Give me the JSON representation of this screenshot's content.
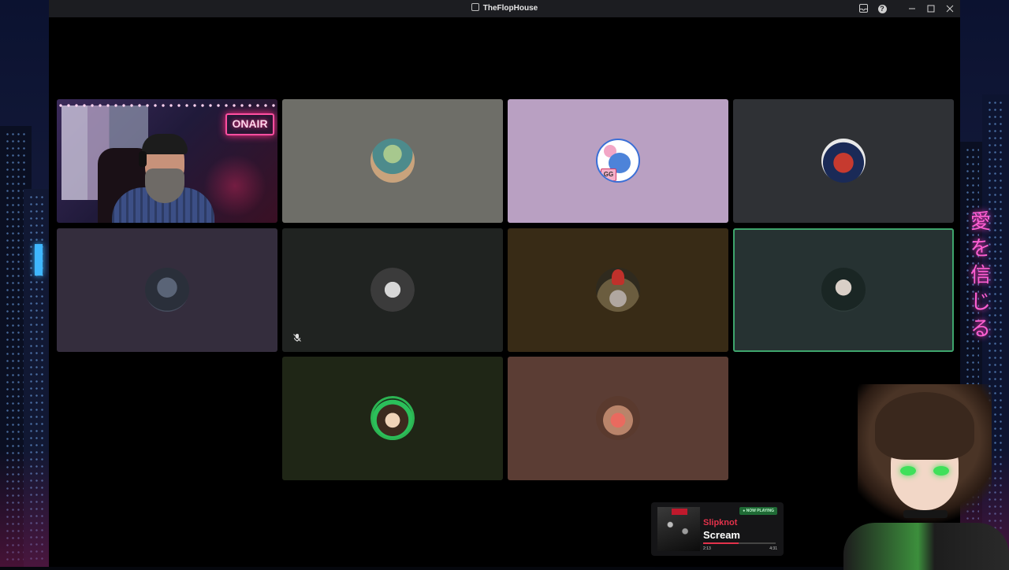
{
  "window": {
    "title": "TheFlopHouse"
  },
  "camera_tile": {
    "sign_text": "ONAIR"
  },
  "participants": [
    {
      "avatar": "camera-feed",
      "bg": "#3a2f4a"
    },
    {
      "avatar": "doll-avatar",
      "bg": "#6e6e68"
    },
    {
      "avatar": "stitch-avatar",
      "bg": "#b9a0c2",
      "avatar_text": "GG"
    },
    {
      "avatar": "badge-avatar",
      "bg": "#2f3135"
    },
    {
      "avatar": "dragon-avatar",
      "bg": "#342d3d"
    },
    {
      "avatar": "skull-avatar",
      "bg": "#202321",
      "muted": true
    },
    {
      "avatar": "gnome-avatar",
      "bg": "#382b16"
    },
    {
      "avatar": "woman-avatar",
      "bg": "#263232",
      "speaking": true
    },
    {
      "avatar": "kid-avatar",
      "bg": "#1f2616"
    },
    {
      "avatar": "girl-avatar",
      "bg": "#5b3d34"
    }
  ],
  "now_playing": {
    "badge": "● NOW PLAYING",
    "artist": "Slipknot",
    "song": "Scream",
    "current_time": "2:13",
    "total_time": "4:31",
    "progress": 0.49
  },
  "colors": {
    "speaking_outline": "#3ea56c",
    "accent_red": "#e3324b",
    "neon_pink": "#ff5fd2"
  },
  "backdrop": {
    "neon_sign_text": "愛を信じる"
  }
}
